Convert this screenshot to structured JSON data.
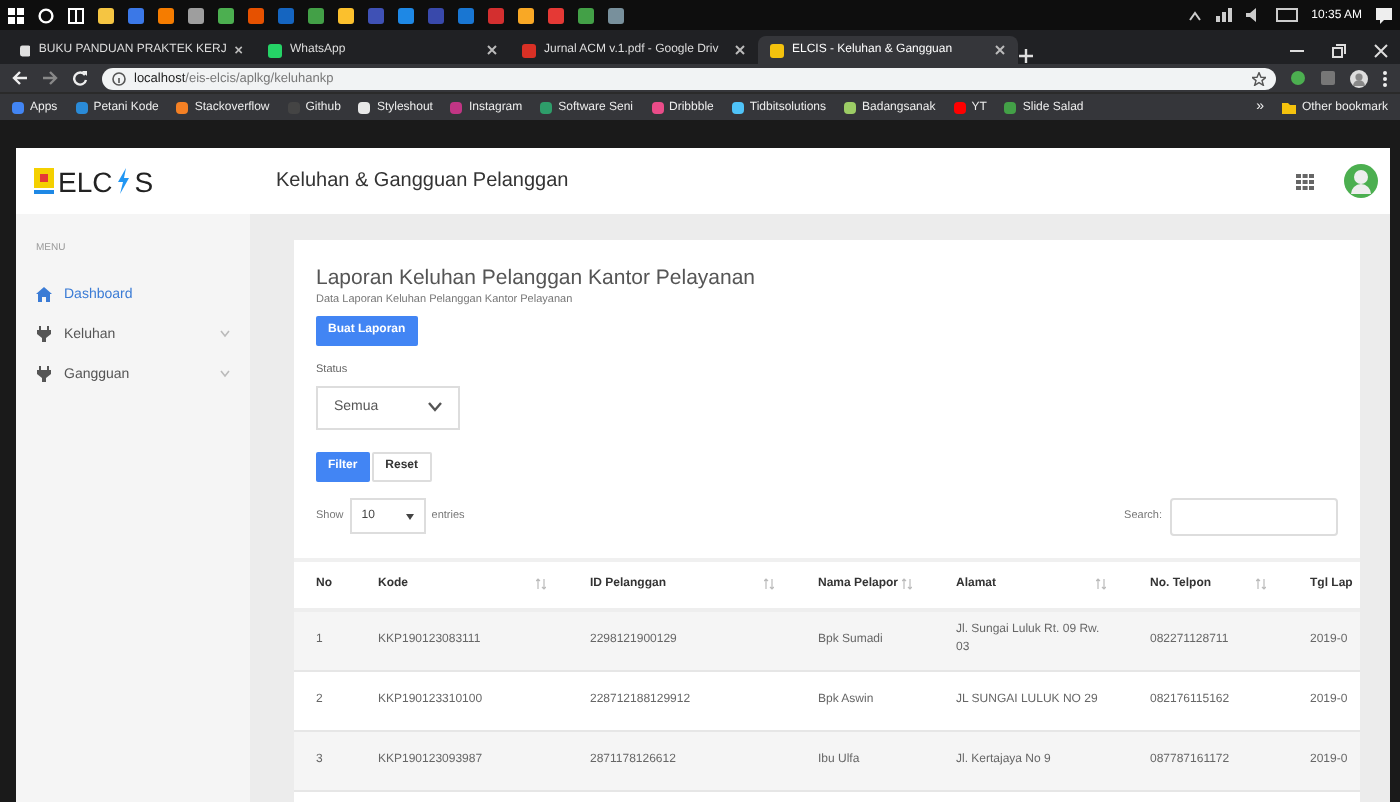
{
  "taskbar": {
    "time": "10:35 AM"
  },
  "browser": {
    "tabs": [
      {
        "title": "BUKU PANDUAN PRAKTEK KERJ",
        "selected": false,
        "color": "#e0e0e0"
      },
      {
        "title": "WhatsApp",
        "selected": false,
        "color": "#25d366"
      },
      {
        "title": "Jurnal ACM v.1.pdf - Google Driv",
        "selected": false,
        "color": "#d93025"
      },
      {
        "title": "ELCIS - Keluhan & Gangguan",
        "selected": true,
        "color": "#f4c20d"
      }
    ],
    "address": {
      "host": "localhost",
      "path": "/eis-elcis/aplkg/keluhankp"
    },
    "bookmarks": [
      {
        "label": "Apps",
        "color": "#4285f4"
      },
      {
        "label": "Petani Kode",
        "color": "#2a8bd8"
      },
      {
        "label": "Stackoverflow",
        "color": "#f48024"
      },
      {
        "label": "Github",
        "color": "#444444"
      },
      {
        "label": "Styleshout",
        "color": "#e8e8e8"
      },
      {
        "label": "Instagram",
        "color": "#c13584"
      },
      {
        "label": "Software Seni",
        "color": "#2e9d6a"
      },
      {
        "label": "Dribbble",
        "color": "#ea4c89"
      },
      {
        "label": "Tidbitsolutions",
        "color": "#4fc3f7"
      },
      {
        "label": "Badangsanak",
        "color": "#9ccc65"
      },
      {
        "label": "YT",
        "color": "#ff0000"
      },
      {
        "label": "Slide Salad",
        "color": "#43a047"
      }
    ],
    "bookmarks_overflow": "»",
    "other_bookmarks": "Other bookmark"
  },
  "app": {
    "brand": {
      "before": "ELC",
      "after": "S"
    },
    "page_title": "Keluhan & Gangguan Pelanggan"
  },
  "sidebar": {
    "heading": "MENU",
    "items": [
      {
        "label": "Dashboard",
        "selected": true,
        "expandable": false,
        "kind": "home"
      },
      {
        "label": "Keluhan",
        "selected": false,
        "expandable": true,
        "kind": "bolt"
      },
      {
        "label": "Gangguan",
        "selected": false,
        "expandable": true,
        "kind": "bolt"
      }
    ]
  },
  "card": {
    "title": "Laporan Keluhan Pelanggan Kantor Pelayanan",
    "subtitle": "Data Laporan Keluhan Pelanggan Kantor Pelayanan",
    "create_button": "Buat Laporan",
    "status": {
      "label": "Status",
      "value": "Semua"
    },
    "filter_button": "Filter",
    "reset_button": "Reset",
    "length": {
      "before": "Show",
      "value": "10",
      "after": "entries"
    },
    "search": {
      "label": "Search:"
    },
    "table": {
      "columns": [
        {
          "label": "No",
          "sortable": false
        },
        {
          "label": "Kode",
          "sortable": true
        },
        {
          "label": "ID Pelanggan",
          "sortable": true
        },
        {
          "label": "Nama Pelapor",
          "sortable": true
        },
        {
          "label": "Alamat",
          "sortable": true
        },
        {
          "label": "No. Telpon",
          "sortable": true
        },
        {
          "label": "Tgl Lap",
          "sortable": false
        }
      ],
      "rows": [
        [
          "1",
          "KKP190123083111",
          "2298121900129",
          "Bpk Sumadi",
          "Jl. Sungai Luluk Rt. 09 Rw. 03",
          "082271128711",
          "2019-0"
        ],
        [
          "2",
          "KKP190123310100",
          "228712188129912",
          "Bpk Aswin",
          "JL SUNGAI LULUK NO 29",
          "082176115162",
          "2019-0"
        ],
        [
          "3",
          "KKP190123093987",
          "2871178126612",
          "Ibu Ulfa",
          "Jl. Kertajaya No 9",
          "087787161172",
          "2019-0"
        ]
      ]
    }
  }
}
